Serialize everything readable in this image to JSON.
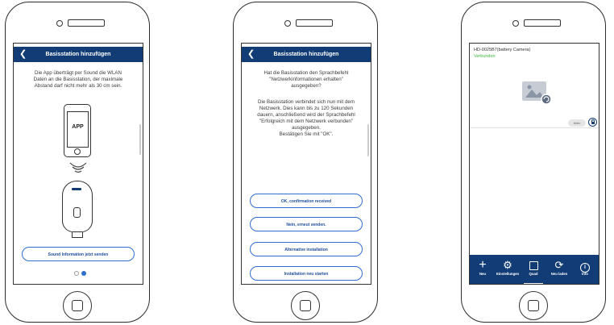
{
  "phone1": {
    "header_title": "Basisstation hinzufügen",
    "back_icon": "chevron-left",
    "instructions": [
      "Die App überträgt per Sound die WLAN",
      "Daten an die Basisstation, der maximale",
      "Abstand darf nicht mehr als 30 cm sein."
    ],
    "phone_label": "APP",
    "send_button": "Sound Information jetzt senden",
    "pager": {
      "total": 2,
      "active": 2
    }
  },
  "phone2": {
    "header_title": "Basisstation hinzufügen",
    "back_icon": "chevron-left",
    "question": [
      "Hat die Basisstation den Sprachbefehl",
      "\"Netzwerkinformationen erhalten\"",
      "ausgegeben?"
    ],
    "info": [
      "Die Basisstation verbindet sich nun mit dem",
      "Netzwerk. Dies kann bis zu 120 Sekunden",
      "dauern, anschließend wird der Sprachbefehl",
      "\"Erfolgreich mit dem Netzwerk verbunden\"",
      "ausgegeben.",
      "Bestätigen Sie mit \"OK\"."
    ],
    "buttons": [
      "OK, confirmation received",
      "Nein, erneut senden.",
      "Alternative installation",
      "Installation neu starten"
    ]
  },
  "phone3": {
    "camera_name": "HD-0025B7(battery Camera)",
    "status": "Verbunden",
    "status_color": "#3db83d",
    "thumbnail_icon": "image-placeholder-icon",
    "toggle_label": "Aktiv",
    "lock_icon": "lock-icon",
    "tabs": [
      {
        "label": "Neu",
        "icon": "plus-icon"
      },
      {
        "label": "Einstellungen",
        "icon": "gear-icon"
      },
      {
        "label": "Quad",
        "icon": "quad-view-icon"
      },
      {
        "label": "Neu laden",
        "icon": "refresh-icon"
      },
      {
        "label": "Info",
        "icon": "info-icon"
      }
    ]
  },
  "colors": {
    "header_blue": "#123c75",
    "button_border": "#2f6fd0"
  }
}
